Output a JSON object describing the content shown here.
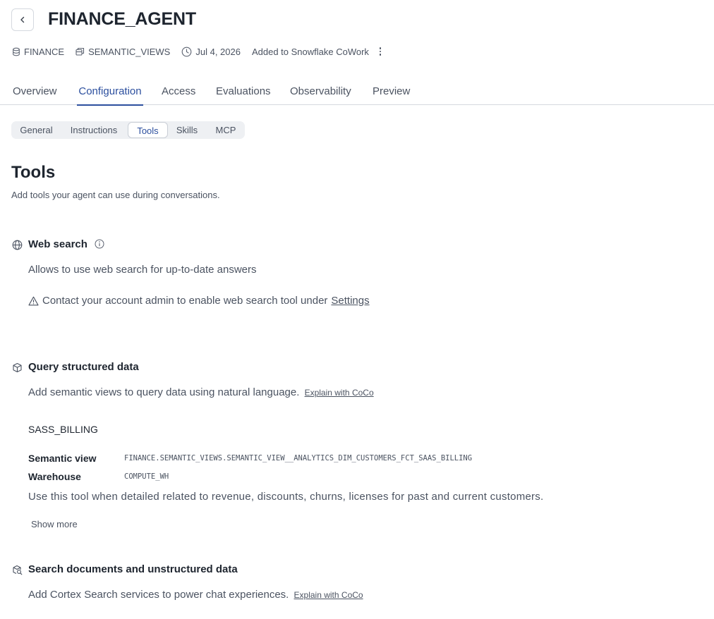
{
  "header": {
    "title": "FINANCE_AGENT",
    "meta": {
      "database": "FINANCE",
      "schema": "SEMANTIC_VIEWS",
      "date": "Jul 4, 2026",
      "status": "Added to Snowflake CoWork"
    }
  },
  "tabs": [
    {
      "label": "Overview"
    },
    {
      "label": "Configuration"
    },
    {
      "label": "Access"
    },
    {
      "label": "Evaluations"
    },
    {
      "label": "Observability"
    },
    {
      "label": "Preview"
    }
  ],
  "active_tab": "Configuration",
  "subtabs": [
    {
      "label": "General"
    },
    {
      "label": "Instructions"
    },
    {
      "label": "Tools"
    },
    {
      "label": "Skills"
    },
    {
      "label": "MCP"
    }
  ],
  "active_subtab": "Tools",
  "page": {
    "title": "Tools",
    "subtitle": "Add tools your agent can use during conversations."
  },
  "web_search": {
    "title": "Web search",
    "description": "Allows to use web search for up-to-date answers",
    "warning": "Contact your account admin to enable web search tool under",
    "warning_link": "Settings"
  },
  "structured": {
    "title": "Query structured data",
    "description": "Add semantic views to query data using natural language.",
    "link": "Explain with CoCo",
    "tool": {
      "name": "SASS_BILLING",
      "semantic_view_label": "Semantic view",
      "semantic_view_value": "FINANCE.SEMANTIC_VIEWS.SEMANTIC_VIEW__ANALYTICS_DIM_CUSTOMERS_FCT_SAAS_BILLING",
      "warehouse_label": "Warehouse",
      "warehouse_value": "COMPUTE_WH",
      "description": "Use this tool when detailed related to revenue, discounts, churns, licenses for past and current customers.",
      "show_more": "Show more"
    }
  },
  "unstructured": {
    "title": "Search documents and unstructured data",
    "description": "Add Cortex Search services to power chat experiences.",
    "link": "Explain with CoCo"
  },
  "colors": {
    "accent": "#2c4f9e",
    "text": "#1e252f",
    "muted": "#4b5361",
    "border": "#d5d9df"
  }
}
